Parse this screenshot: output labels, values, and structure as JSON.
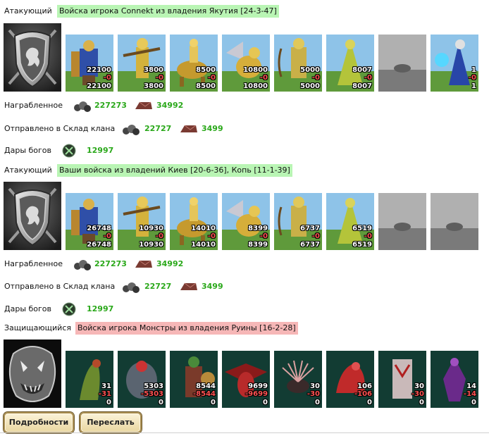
{
  "battle1": {
    "role": "Атакующий",
    "army_label": "Войска игрока Connekt из владения Якутия [24-3-47]",
    "units": [
      {
        "kind": "knight",
        "a": "22100",
        "b": "-0",
        "c": "22100"
      },
      {
        "kind": "crossbow",
        "a": "3800",
        "b": "-0",
        "c": "3800"
      },
      {
        "kind": "cavalry",
        "a": "8500",
        "b": "-0",
        "c": "8500"
      },
      {
        "kind": "griffin",
        "a": "10800",
        "b": "-0",
        "c": "10800"
      },
      {
        "kind": "archer",
        "a": "5000",
        "b": "-0",
        "c": "5000"
      },
      {
        "kind": "priest",
        "a": "8007",
        "b": "-0",
        "c": "8007"
      },
      {
        "kind": "empty",
        "a": "",
        "b": "",
        "c": ""
      },
      {
        "kind": "mage",
        "a": "1",
        "b": "-0",
        "c": "1"
      }
    ],
    "loot_label": "Награбленное",
    "loot_iron": "227273",
    "loot_ore": "34992",
    "sent_label": "Отправлено в Склад клана",
    "sent_iron": "22727",
    "sent_ore": "3499",
    "gifts_label": "Дары богов",
    "gifts_value": "12997"
  },
  "battle2": {
    "role": "Атакующий",
    "army_label": "Ваши войска из владений Киев [20-6-36], Копь [11-1-39]",
    "units": [
      {
        "kind": "knight",
        "a": "26748",
        "b": "-0",
        "c": "26748"
      },
      {
        "kind": "crossbow",
        "a": "10930",
        "b": "-0",
        "c": "10930"
      },
      {
        "kind": "cavalry",
        "a": "14010",
        "b": "-0",
        "c": "14010"
      },
      {
        "kind": "griffin",
        "a": "8399",
        "b": "-0",
        "c": "8399"
      },
      {
        "kind": "archer",
        "a": "6737",
        "b": "-0",
        "c": "6737"
      },
      {
        "kind": "priest",
        "a": "6519",
        "b": "-0",
        "c": "6519"
      },
      {
        "kind": "empty",
        "a": "",
        "b": "",
        "c": ""
      },
      {
        "kind": "empty",
        "a": "",
        "b": "",
        "c": ""
      }
    ],
    "loot_label": "Награбленное",
    "loot_iron": "227273",
    "loot_ore": "34992",
    "sent_label": "Отправлено в Склад клана",
    "sent_iron": "22727",
    "sent_ore": "3499",
    "gifts_label": "Дары богов",
    "gifts_value": "12997"
  },
  "defender": {
    "role": "Защищающийся",
    "army_label": "Войска игрока Монстры из владения Руины [16-2-28]",
    "units": [
      {
        "kind": "lizard",
        "a": "31",
        "b": "-31",
        "c": "0"
      },
      {
        "kind": "golem",
        "a": "5303",
        "b": "-5303",
        "c": "0"
      },
      {
        "kind": "orc",
        "a": "8544",
        "b": "-8544",
        "c": "0"
      },
      {
        "kind": "demon",
        "a": "9699",
        "b": "-9699",
        "c": "0"
      },
      {
        "kind": "spider",
        "a": "30",
        "b": "-30",
        "c": "0"
      },
      {
        "kind": "beast",
        "a": "106",
        "b": "-106",
        "c": "0"
      },
      {
        "kind": "totem",
        "a": "30",
        "b": "-30",
        "c": "0"
      },
      {
        "kind": "wraith",
        "a": "14",
        "b": "-14",
        "c": "0"
      }
    ]
  },
  "buttons": {
    "details": "Подробности",
    "forward": "Переслать"
  },
  "colors": {
    "green_tag": "#b9f5b4",
    "red_tag": "#f6b7b7",
    "resource_value": "#2aa81a",
    "loss_value": "#ff5252"
  }
}
